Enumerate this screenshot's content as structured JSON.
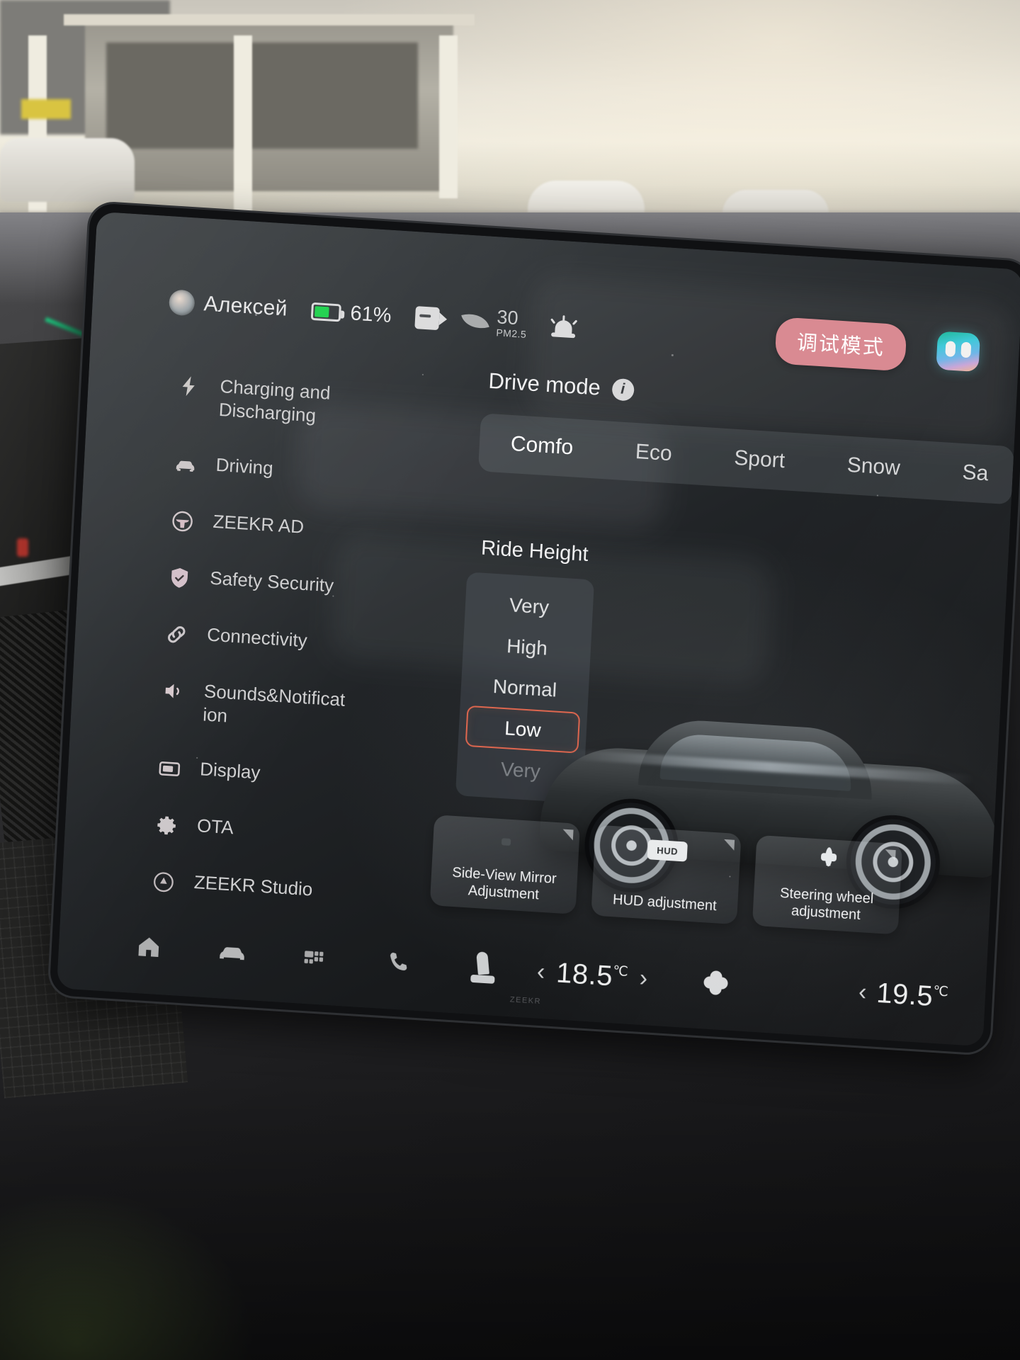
{
  "statusbar": {
    "user_name": "Алексей",
    "avatar_icon": "user-avatar",
    "battery_icon": "battery-icon",
    "battery_percent": "61%",
    "battery_level": 61,
    "dashcam_icon": "dashcam-icon",
    "air_quality_icon": "leaf-icon",
    "pm_value": "30",
    "pm_unit": "PM2.5",
    "hazard_icon": "siren-icon",
    "debug_badge": "调试模式",
    "assistant_icon": "voice-assistant-icon",
    "accent_badge_color": "#d98a92"
  },
  "sidebar": {
    "items": [
      {
        "label": "Charging and Discharging",
        "icon": "bolt-icon"
      },
      {
        "label": "Driving",
        "icon": "car-icon"
      },
      {
        "label": "ZEEKR AD",
        "icon": "steering-wheel-icon"
      },
      {
        "label": "Safety Security",
        "icon": "shield-check-icon"
      },
      {
        "label": "Connectivity",
        "icon": "link-icon"
      },
      {
        "label": "Sounds&Notificat ion",
        "icon": "speaker-icon"
      },
      {
        "label": "Display",
        "icon": "monitor-icon"
      },
      {
        "label": "OTA",
        "icon": "gear-icon"
      },
      {
        "label": "ZEEKR Studio",
        "icon": "studio-icon"
      }
    ]
  },
  "main": {
    "drive_mode": {
      "title": "Drive mode",
      "info_icon": "info-icon",
      "tabs": [
        {
          "label": "Comfo",
          "active": true
        },
        {
          "label": "Eco",
          "active": false
        },
        {
          "label": "Sport",
          "active": false
        },
        {
          "label": "Snow",
          "active": false
        },
        {
          "label": "Sa",
          "active": false
        }
      ]
    },
    "ride_height": {
      "title": "Ride Height",
      "options": [
        {
          "label": "Very",
          "state": "normal"
        },
        {
          "label": "High",
          "state": "normal"
        },
        {
          "label": "Normal",
          "state": "normal"
        },
        {
          "label": "Low",
          "state": "selected"
        },
        {
          "label": "Very",
          "state": "dim"
        }
      ],
      "selected": "Low",
      "selected_border_color": "#e0674f"
    },
    "quick_cards": [
      {
        "label": "Side-View Mirror Adjustment",
        "icon": "side-mirror-icon"
      },
      {
        "label": "HUD adjustment",
        "icon": "hud-icon",
        "chip": "HUD"
      },
      {
        "label": "Steering wheel adjustment",
        "icon": "steering-wheel-icon"
      }
    ]
  },
  "dock": {
    "icons": [
      "home-icon",
      "car-icon",
      "apps-icon",
      "phone-icon",
      "seat-icon"
    ],
    "driver_climate": {
      "prev_icon": "chevron-left-icon",
      "temperature": "18.5",
      "unit": "℃",
      "next_icon": "chevron-right-icon"
    },
    "fan_icon": "fan-icon",
    "passenger_climate": {
      "prev_icon": "chevron-left-icon",
      "temperature": "19.5",
      "unit": "℃"
    },
    "watermark": "ZEEKR"
  }
}
